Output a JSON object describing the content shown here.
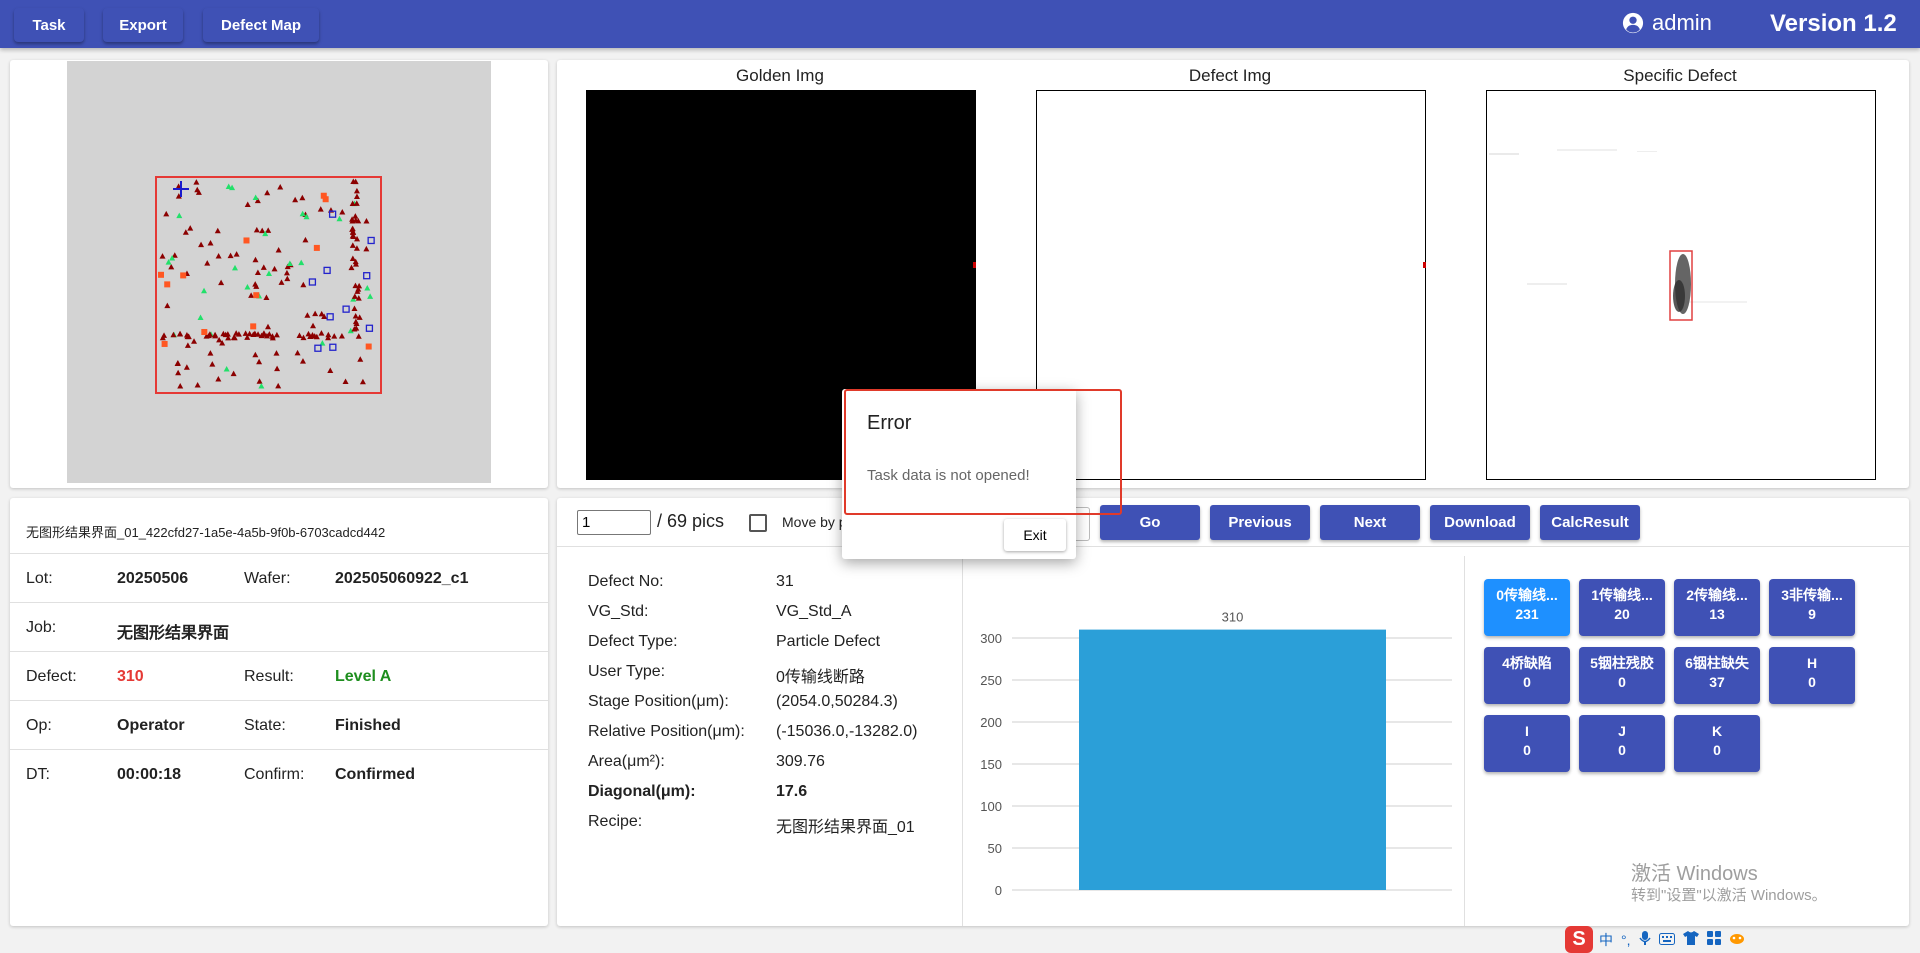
{
  "header": {
    "task_label": "Task",
    "export_label": "Export",
    "defect_map_label": "Defect Map",
    "user": "admin",
    "version": "Version 1.2"
  },
  "images": {
    "golden_title": "Golden Img",
    "defect_title": "Defect Img",
    "specific_title": "Specific Defect"
  },
  "info": {
    "file_name": "无图形结果界面_01_422cfd27-1a5e-4a5b-9f0b-6703cadcd442",
    "lot_label": "Lot:",
    "lot": "20250506",
    "wafer_label": "Wafer:",
    "wafer": "202505060922_c1",
    "job_label": "Job:",
    "job": "无图形结果界面",
    "defect_label": "Defect:",
    "defect": "310",
    "result_label": "Result:",
    "result": "Level A",
    "op_label": "Op:",
    "op": "Operator",
    "state_label": "State:",
    "state": "Finished",
    "dt_label": "DT:",
    "dt": "00:00:18",
    "confirm_label": "Confirm:",
    "confirm": "Confirmed"
  },
  "nav": {
    "pic_value": "1",
    "pic_total": "/ 69 pics",
    "move_label": "Move by p",
    "go": "Go",
    "previous": "Previous",
    "next": "Next",
    "download": "Download",
    "calc": "CalcResult"
  },
  "details": {
    "rows": [
      {
        "k": "Defect No:",
        "v": "31"
      },
      {
        "k": "VG_Std:",
        "v": "VG_Std_A"
      },
      {
        "k": "Defect Type:",
        "v": "Particle Defect"
      },
      {
        "k": "User Type:",
        "v": "0传输线断路"
      },
      {
        "k": "Stage Position(μm):",
        "v": "(2054.0,50284.3)"
      },
      {
        "k": "Relative Position(μm):",
        "v": "(-15036.0,-13282.0)"
      },
      {
        "k": "Area(μm²):",
        "v": "309.76"
      },
      {
        "k": "Diagonal(μm):",
        "v": "17.6"
      },
      {
        "k": "Recipe:",
        "v": "无图形结果界面_01"
      }
    ]
  },
  "chart_data": {
    "type": "bar",
    "categories": [
      ""
    ],
    "values": [
      310
    ],
    "ylim": [
      0,
      300
    ],
    "yticks": [
      "0",
      "50",
      "100",
      "150",
      "200",
      "250",
      "300"
    ],
    "data_label": "310",
    "color": "#2b9fd8",
    "grid": true
  },
  "classes": [
    {
      "label": "0传输线断路",
      "display": "0传输线...",
      "count": "231",
      "active": true
    },
    {
      "label": "1传输线",
      "display": "1传输线...",
      "count": "20",
      "active": false
    },
    {
      "label": "2传输线",
      "display": "2传输线...",
      "count": "13",
      "active": false
    },
    {
      "label": "3非传输",
      "display": "3非传输...",
      "count": "9",
      "active": false
    },
    {
      "label": "4桥缺陷",
      "display": "4桥缺陷",
      "count": "0",
      "active": false
    },
    {
      "label": "5铟柱残胶",
      "display": "5铟柱残胶",
      "count": "0",
      "active": false
    },
    {
      "label": "6铟柱缺失",
      "display": "6铟柱缺失",
      "count": "37",
      "active": false
    },
    {
      "label": "H",
      "display": "H",
      "count": "0",
      "active": false
    },
    {
      "label": "I",
      "display": "I",
      "count": "0",
      "active": false
    },
    {
      "label": "J",
      "display": "J",
      "count": "0",
      "active": false
    },
    {
      "label": "K",
      "display": "K",
      "count": "0",
      "active": false
    }
  ],
  "watermark": {
    "line1": "激活 Windows",
    "line2": "转到\"设置\"以激活 Windows。"
  },
  "ime": {
    "logo": "S",
    "lang": "中",
    "punct": "°,"
  },
  "dialog": {
    "title": "Error",
    "message": "Task data is not opened!",
    "exit": "Exit"
  },
  "colors": {
    "primary": "#3f51b5",
    "active_class": "#1e90ff",
    "defect_count": "#e53935",
    "result_ok": "#1e8e1e",
    "bar": "#2b9fd8",
    "dialog_highlight": "#e03a2a"
  }
}
